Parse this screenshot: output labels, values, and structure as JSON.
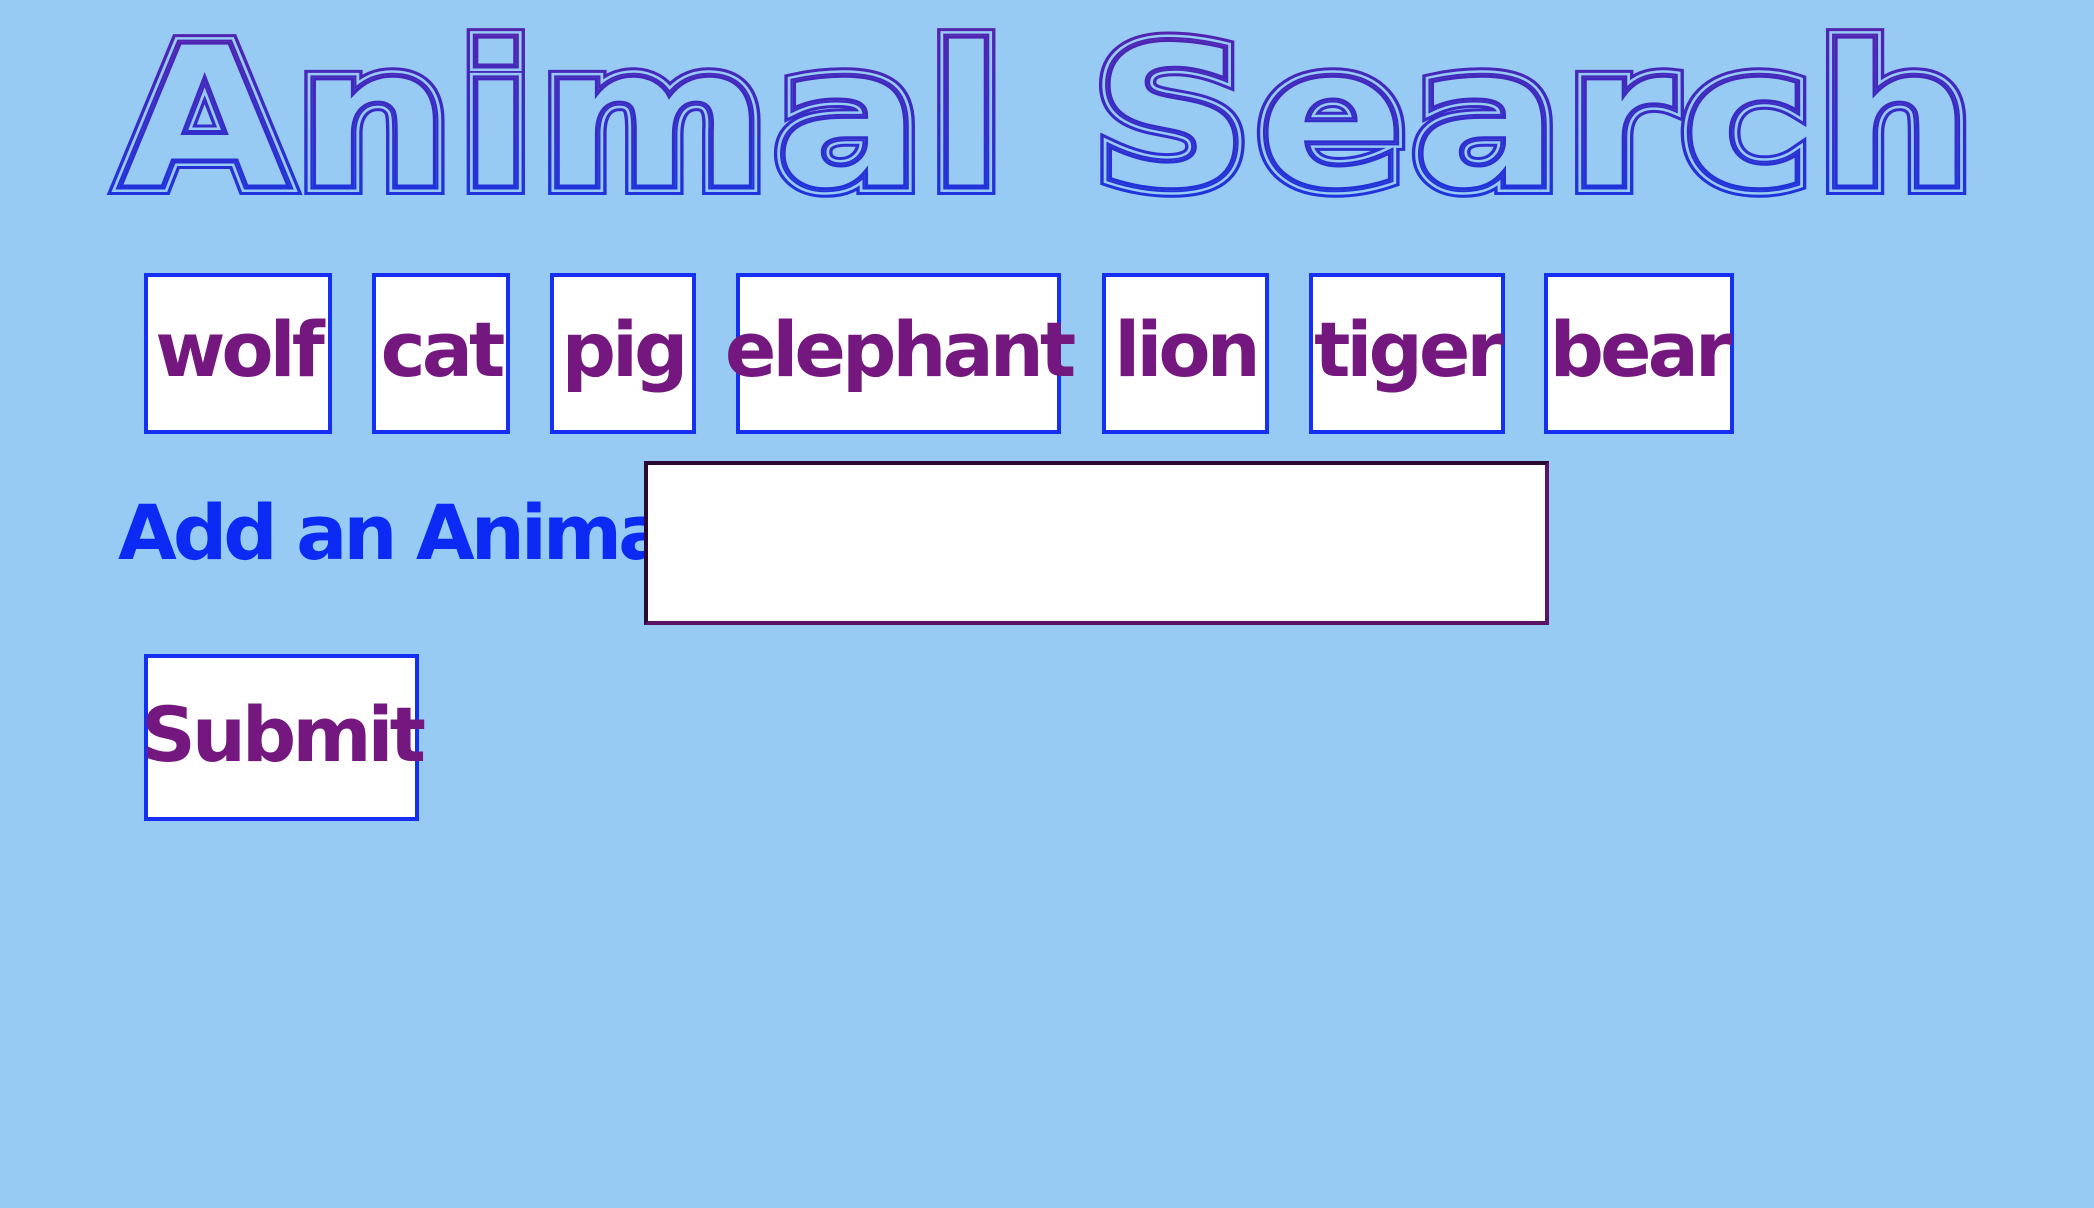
{
  "page": {
    "title": "Animal Search"
  },
  "colors": {
    "background": "#97cbf3",
    "title_stroke_start": "#5a21a9",
    "title_stroke_end": "#1437e6",
    "button_border": "#1530f2",
    "button_text": "#74187f",
    "label_text": "#0b2bf5",
    "input_border": "#5b1366"
  },
  "animals": [
    {
      "label": "wolf"
    },
    {
      "label": "cat"
    },
    {
      "label": "pig"
    },
    {
      "label": "elephant"
    },
    {
      "label": "lion"
    },
    {
      "label": "tiger"
    },
    {
      "label": "bear"
    }
  ],
  "form": {
    "label": "Add an Animal",
    "input_value": "",
    "submit_label": "Submit"
  }
}
